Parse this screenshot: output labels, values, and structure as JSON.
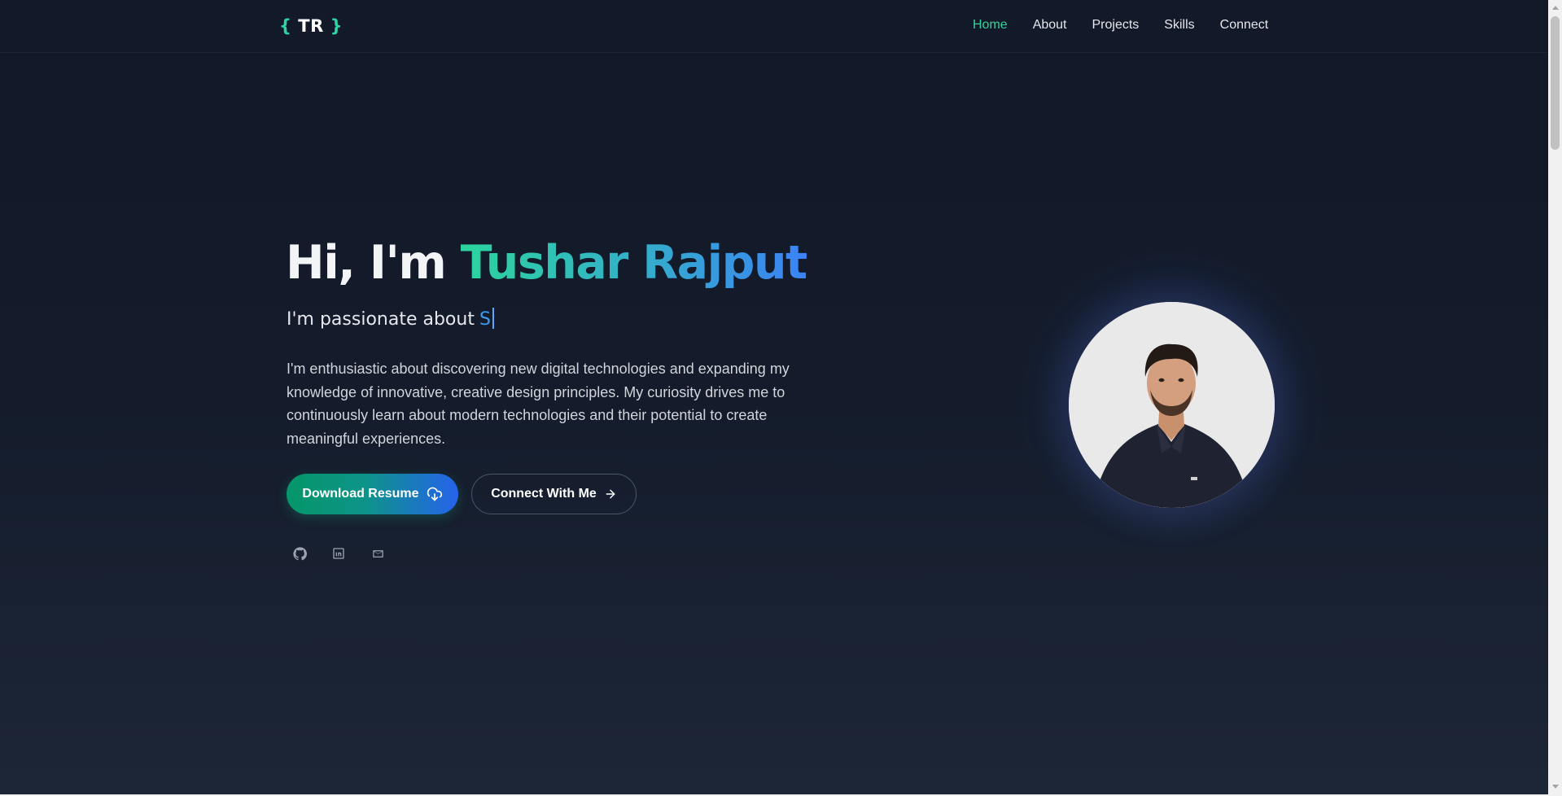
{
  "header": {
    "logo_open": "{",
    "logo_text": "TR",
    "logo_close": "}",
    "nav": [
      {
        "label": "Home",
        "active": true
      },
      {
        "label": "About"
      },
      {
        "label": "Projects"
      },
      {
        "label": "Skills"
      },
      {
        "label": "Connect"
      }
    ]
  },
  "hero": {
    "greeting": "Hi, I'm ",
    "name": "Tushar Rajput",
    "subtitle_prefix": "I'm passionate about",
    "subtitle_typed": "S",
    "bio": "I'm enthusiastic about discovering new digital technologies and expanding my knowledge of innovative, creative design principles. My curiosity drives me to continuously learn about modern technologies and their potential to create meaningful experiences.",
    "primary_button": "Download Resume",
    "primary_button_icon": "cloud-download-icon",
    "secondary_button": "Connect With Me",
    "secondary_button_icon": "arrow-right-icon",
    "socials": [
      "github-icon",
      "linkedin-icon",
      "mail-icon"
    ]
  },
  "colors": {
    "accent_green": "#34d399",
    "accent_blue": "#3b82f6",
    "background": "#111827"
  }
}
